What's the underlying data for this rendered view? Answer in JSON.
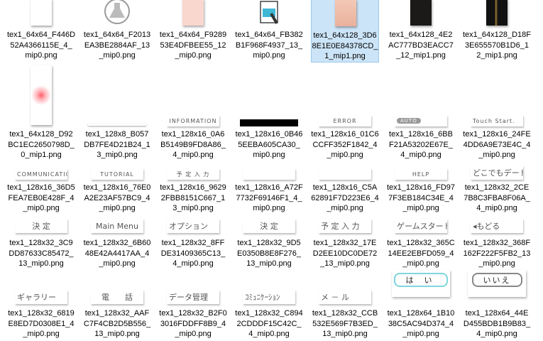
{
  "files": [
    {
      "name": "tex1_64x64_F446D52A4366115E_4_mip0.png",
      "thumb": "tall-white",
      "selected": false
    },
    {
      "name": "tex1_64x64_F2013EA3BE2884AF_13_mip0.png",
      "thumb": "flask-icon",
      "selected": false
    },
    {
      "name": "tex1_64x64_F928953E4DFBEE55_12_mip0.png",
      "thumb": "tall-pink",
      "selected": false
    },
    {
      "name": "tex1_64x64_FB382B1F968F4937_13_mip0.png",
      "thumb": "notebook-icon",
      "selected": false
    },
    {
      "name": "tex1_64x128_3D68E1E0E84378CD_1_mip1.png",
      "thumb": "face",
      "selected": true
    },
    {
      "name": "tex1_64x128_4E2AC777BD3EACC7_12_mip1.png",
      "thumb": "dark-belt",
      "selected": false
    },
    {
      "name": "tex1_64x128_D18F3E655570B1D6_12_mip1.png",
      "thumb": "black-gold",
      "selected": false
    },
    {
      "name": "tex1_64x128_D92BC1EC2650798D_0_mip1.png",
      "thumb": "glow",
      "selected": false
    },
    {
      "name": "tex1_128x8_B057DB7FE4D21B24_13_mip0.png",
      "thumb": "thin-line",
      "selected": false
    },
    {
      "name": "tex1_128x16_0A6B5149B9FD8A86_4_mip0.png",
      "thumb": "strip",
      "text": "INFORMATION",
      "selected": false
    },
    {
      "name": "tex1_128x16_0B465EEBA605CA30_mip0.png",
      "thumb": "black-bar",
      "selected": false
    },
    {
      "name": "tex1_128x16_01C6CCFF352F1842_4_mip0.png",
      "thumb": "strip",
      "text": "ERROR",
      "selected": false
    },
    {
      "name": "tex1_128x16_6BBF21A53202E67E_4_mip0.png",
      "thumb": "strip-auto",
      "text": "AUTO",
      "selected": false
    },
    {
      "name": "tex1_128x16_24FE4DD6A9E73E4C_4_mip0.png",
      "thumb": "strip-left",
      "text": "Touch Start.",
      "selected": false
    },
    {
      "name": "tex1_128x16_36D5FEA7EB0E428F_4_mip0.png",
      "thumb": "strip-left",
      "text": "COMMUNICATION",
      "selected": false
    },
    {
      "name": "tex1_128x16_76E0A2E23AF57BC9_4_mip0.png",
      "thumb": "strip",
      "text": "TUTORIAL",
      "selected": false
    },
    {
      "name": "tex1_128x16_96292FBB8151C667_13_mip0.png",
      "thumb": "strip",
      "text": "予 定 入 力",
      "selected": false
    },
    {
      "name": "tex1_128x16_A72F7732F69146F1_4_mip0.png",
      "thumb": "strip",
      "text": "",
      "selected": false
    },
    {
      "name": "tex1_128x16_C5A62891F7D223E6_4_mip0.png",
      "thumb": "strip",
      "text": "",
      "selected": false
    },
    {
      "name": "tex1_128x16_FD977F3EB184C34E_4_mip0.png",
      "thumb": "strip",
      "text": "HELP",
      "selected": false
    },
    {
      "name": "tex1_128x32_2CE7B8C3FBA8F06A_4_mip0.png",
      "thumb": "strip-big-left",
      "text": "どこでもデート",
      "selected": false
    },
    {
      "name": "tex1_128x32_3C9DD87633C85472_13_mip0.png",
      "thumb": "strip-big",
      "text": "決 定",
      "selected": false
    },
    {
      "name": "tex1_128x32_6B6048E42A4417AA_4_mip0.png",
      "thumb": "strip-big",
      "text": "Main Menu",
      "selected": false
    },
    {
      "name": "tex1_128x32_8FFDE31409365C13_4_mip0.png",
      "thumb": "strip-big-left",
      "text": "オプション",
      "selected": false
    },
    {
      "name": "tex1_128x32_9D5E0350B8E8F276_13_mip0.png",
      "thumb": "strip-big",
      "text": "決 定",
      "selected": false
    },
    {
      "name": "tex1_128x32_17ED2EE10DC0DE72_13_mip0.png",
      "thumb": "strip-big-left",
      "text": "予 定 入 力",
      "selected": false
    },
    {
      "name": "tex1_128x32_365C14EE2EBFD059_4_mip0.png",
      "thumb": "strip-big-left",
      "text": "ゲームスタート",
      "selected": false
    },
    {
      "name": "tex1_128x32_368F162F222F5FB2_13_mip0.png",
      "thumb": "strip-big-left",
      "text": "◂もどる",
      "selected": false
    },
    {
      "name": "tex1_128x32_6819E8ED7D0308E1_4_mip0.png",
      "thumb": "strip-big-left",
      "text": "ギャラリー",
      "selected": false
    },
    {
      "name": "tex1_128x32_AAFC7F4CB2D5B556_13_mip0.png",
      "thumb": "strip-big",
      "text": "電　　話",
      "selected": false
    },
    {
      "name": "tex1_128x32_B2F03016FDDFF8B9_4_mip0.png",
      "thumb": "strip-big-left",
      "text": "データ管理",
      "selected": false
    },
    {
      "name": "tex1_128x32_C8942CDDDF15C42C_4_mip0.png",
      "thumb": "strip-big-left",
      "text": "ｺﾐｭﾆｹｰｼｮﾝ",
      "selected": false
    },
    {
      "name": "tex1_128x32_CCB532E569F7B3ED_13_mip0.png",
      "thumb": "strip-big-left",
      "text": "メ － ル",
      "selected": false
    },
    {
      "name": "tex1_128x64_1B1038C5AC94D374_4_mip0.png",
      "thumb": "pill",
      "text": "は い",
      "selected": false
    },
    {
      "name": "tex1_128x64_44ED455BDB1B9B83_4_mip0.png",
      "thumb": "pill-gray",
      "text": "いいえ",
      "selected": false
    }
  ]
}
